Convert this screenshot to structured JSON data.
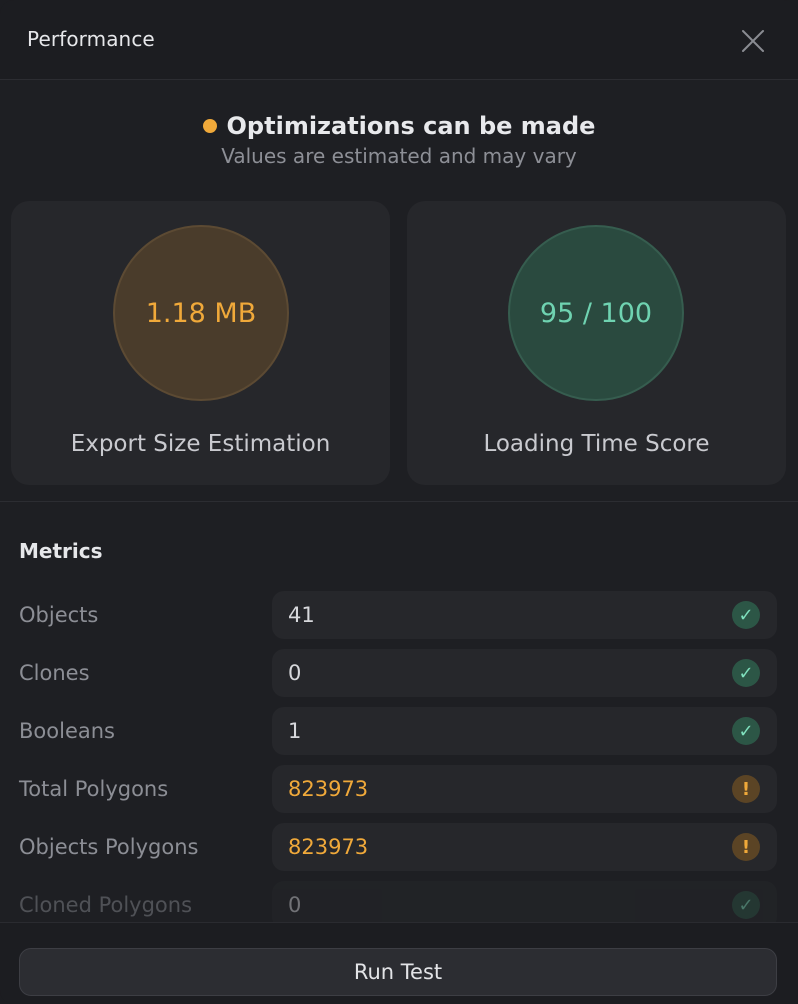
{
  "header": {
    "title": "Performance",
    "close_icon": "close-icon"
  },
  "status": {
    "title": "Optimizations can be made",
    "subtitle": "Values are estimated and may vary",
    "dot_color": "#f0a93a"
  },
  "cards": {
    "export": {
      "value": "1.18 MB",
      "label": "Export Size Estimation",
      "color": "#f0a93a"
    },
    "loading": {
      "value": "95 / 100",
      "label": "Loading Time Score",
      "color": "#6fd3b1"
    }
  },
  "metrics": {
    "title": "Metrics",
    "rows": [
      {
        "label": "Objects",
        "value": "41",
        "status": "ok"
      },
      {
        "label": "Clones",
        "value": "0",
        "status": "ok"
      },
      {
        "label": "Booleans",
        "value": "1",
        "status": "ok"
      },
      {
        "label": "Total Polygons",
        "value": "823973",
        "status": "warn"
      },
      {
        "label": "Objects Polygons",
        "value": "823973",
        "status": "warn"
      },
      {
        "label": "Cloned Polygons",
        "value": "0",
        "status": "ok"
      }
    ]
  },
  "footer": {
    "run_label": "Run Test"
  }
}
